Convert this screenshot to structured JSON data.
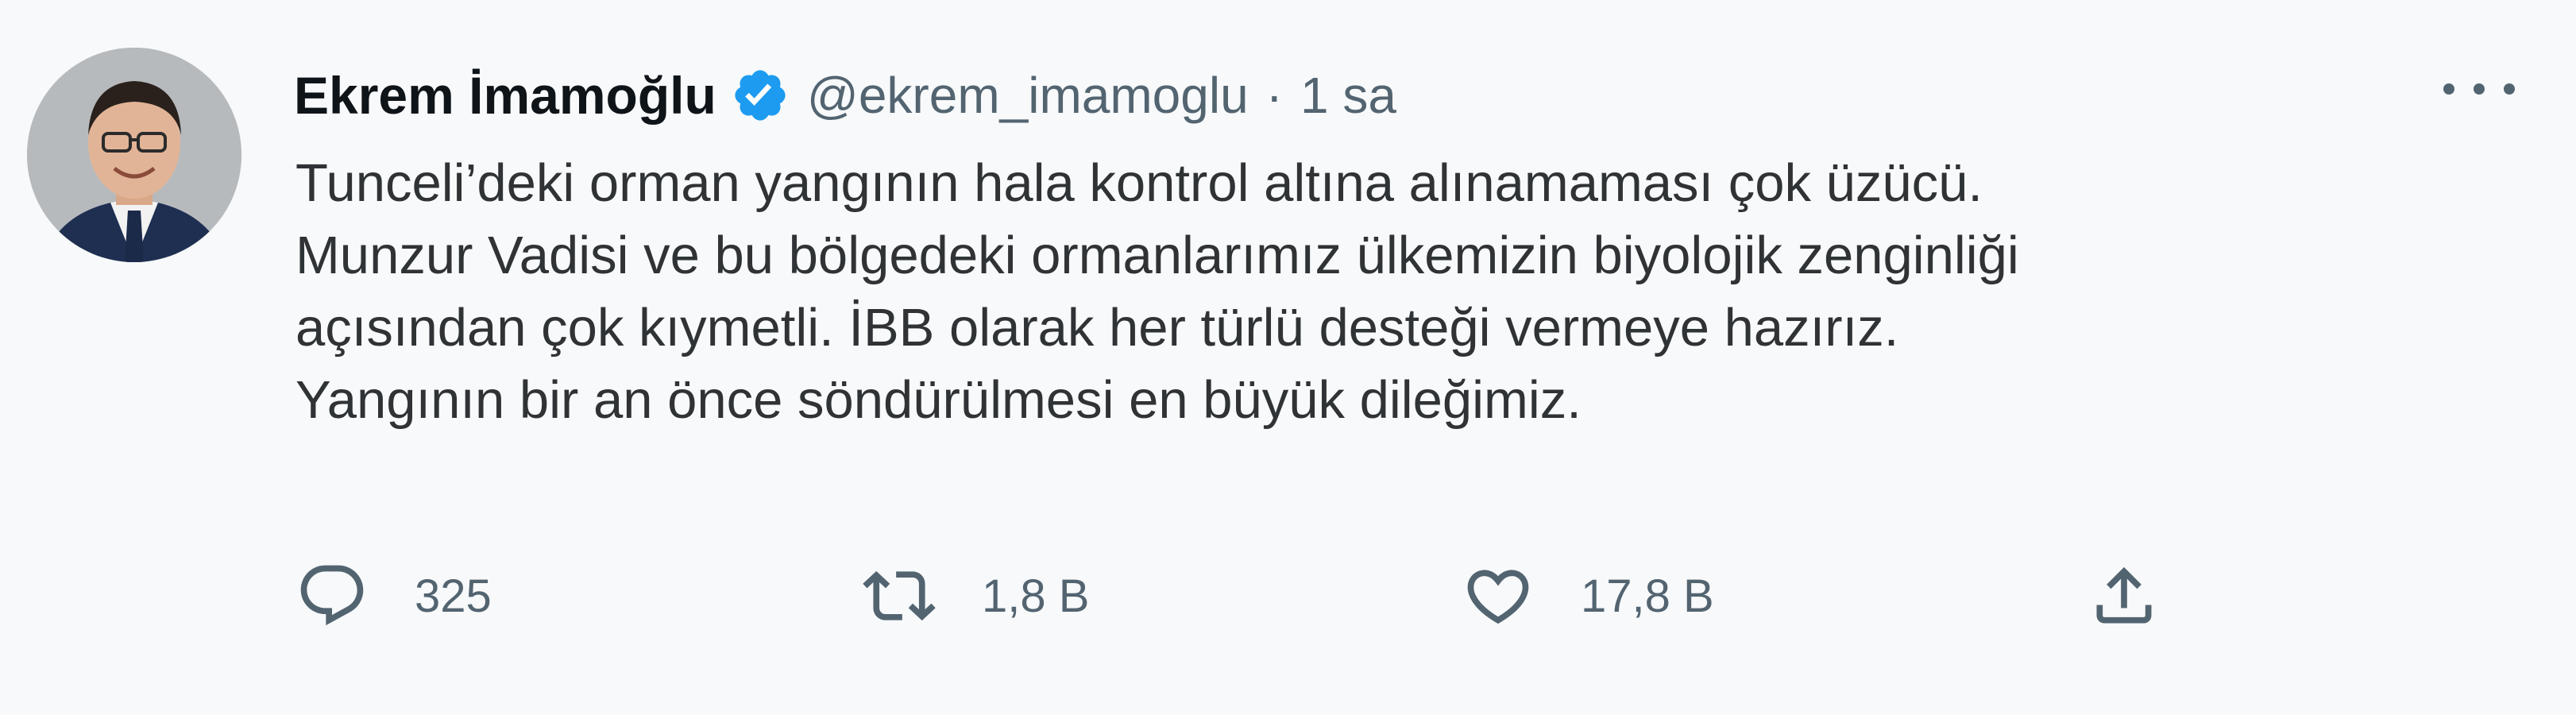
{
  "tweet": {
    "display_name": "Ekrem İmamoğlu",
    "handle": "@ekrem_imamoglu",
    "separator": "·",
    "time": "1 sa",
    "verified_icon": "verified-badge-icon",
    "more_icon": "more-options-icon",
    "text_lines": [
      "Tunceli’deki orman yangının hala kontrol altına alınamaması çok üzücü.",
      "Munzur Vadisi ve bu bölgedeki ormanlarımız ülkemizin biyolojik zenginliği",
      "açısından çok kıymetli. İBB olarak her türlü desteği vermeye hazırız.",
      "Yangının bir an önce söndürülmesi en büyük dileğimiz."
    ]
  },
  "actions": {
    "reply": {
      "icon": "reply-icon",
      "count": "325"
    },
    "retweet": {
      "icon": "retweet-icon",
      "count": "1,8 B"
    },
    "like": {
      "icon": "heart-icon",
      "count": "17,8 B"
    },
    "share": {
      "icon": "share-icon"
    }
  },
  "colors": {
    "background": "#f7f9fa",
    "text": "#2f3336",
    "secondary": "#536471",
    "verified": "#1d9bf0"
  }
}
